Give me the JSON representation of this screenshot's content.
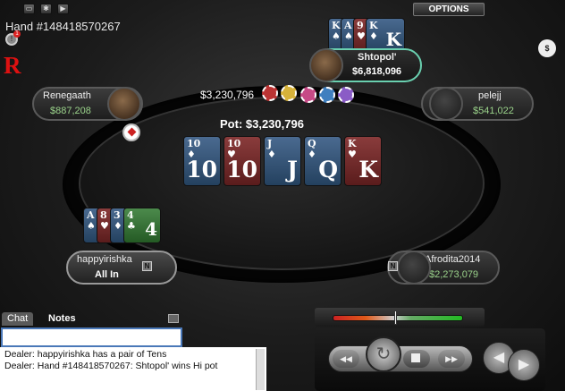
{
  "toolbar": {
    "icons": [
      "window-icon",
      "settings-icon",
      "play-icon"
    ],
    "options_label": "OPTIONS"
  },
  "hand": {
    "number": "Hand #148418570267"
  },
  "players": {
    "top": {
      "name": "Shtopol'",
      "stack": "$6,818,096"
    },
    "left": {
      "name": "Renegaath",
      "stack": "$887,208"
    },
    "right": {
      "name": "pelejj",
      "stack": "$541,022"
    },
    "hero": {
      "name": "happyirishka",
      "status": "All In",
      "badge": "N"
    },
    "bottom_right": {
      "name": "Afrodita2014",
      "stack": "$2,273,079",
      "badge": "N"
    }
  },
  "bet": {
    "amount": "$3,230,796"
  },
  "pot": {
    "label": "Pot: $3,230,796"
  },
  "board": [
    {
      "rank": "10",
      "suit": "♦",
      "color": "blue"
    },
    {
      "rank": "10",
      "suit": "♥",
      "color": "red"
    },
    {
      "rank": "J",
      "suit": "♦",
      "color": "blue"
    },
    {
      "rank": "Q",
      "suit": "♦",
      "color": "blue"
    },
    {
      "rank": "K",
      "suit": "♥",
      "color": "red"
    }
  ],
  "top_hand": [
    {
      "rank": "K",
      "suit": "♠",
      "color": "blue"
    },
    {
      "rank": "A",
      "suit": "♠",
      "color": "blue"
    },
    {
      "rank": "9",
      "suit": "♥",
      "color": "red"
    },
    {
      "rank": "K",
      "suit": "♦",
      "color": "blue"
    }
  ],
  "hero_hand": [
    {
      "rank": "A",
      "suit": "♠",
      "color": "blue"
    },
    {
      "rank": "8",
      "suit": "♥",
      "color": "red"
    },
    {
      "rank": "3",
      "suit": "♦",
      "color": "blue"
    },
    {
      "rank": "4",
      "suit": "♣",
      "color": "green"
    }
  ],
  "chat": {
    "tab_chat": "Chat",
    "tab_notes": "Notes",
    "lines": [
      "Dealer: happyirishka has a pair of Tens",
      "Dealer: Hand #148418570267: Shtopol' wins Hi pot"
    ]
  },
  "colors": {
    "accent_green": "#9ad28a",
    "active_seat": "#6ad0b0",
    "real_money_red": "#d11"
  }
}
